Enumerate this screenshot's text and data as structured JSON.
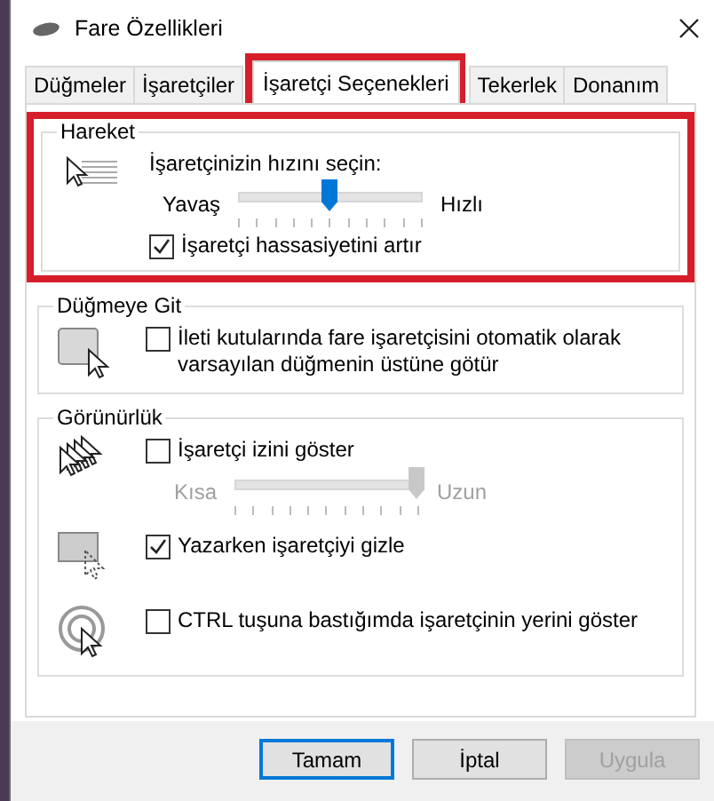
{
  "window": {
    "title": "Fare Özellikleri"
  },
  "tabs": [
    {
      "label": "Düğmeler",
      "selected": false,
      "highlighted": false
    },
    {
      "label": "İşaretçiler",
      "selected": false,
      "highlighted": false
    },
    {
      "label": "İşaretçi Seçenekleri",
      "selected": true,
      "highlighted": true
    },
    {
      "label": "Tekerlek",
      "selected": false,
      "highlighted": false
    },
    {
      "label": "Donanım",
      "selected": false,
      "highlighted": false
    }
  ],
  "groups": [
    {
      "title": "Hareket",
      "highlighted": true,
      "sections": [
        {
          "items": [
            {
              "kind": "text",
              "text": "İşaretçinizin hızını seçin:"
            },
            {
              "kind": "slider",
              "min_label": "Yavaş",
              "max_label": "Hızlı",
              "level": 0.5,
              "disabled": false
            },
            {
              "kind": "checkbox",
              "label": "İşaretçi hassasiyetini artır",
              "checked": true
            }
          ]
        }
      ]
    },
    {
      "title": "Düğmeye Git",
      "highlighted": false,
      "sections": [
        {
          "items": [
            {
              "kind": "checkbox",
              "label": "İleti kutularında fare işaretçisini otomatik olarak varsayılan düğmenin üstüne götür",
              "checked": false
            }
          ]
        }
      ]
    },
    {
      "title": "Görünürlük",
      "highlighted": false,
      "sections": [
        {
          "items": [
            {
              "kind": "checkbox",
              "label": "İşaretçi izini göster",
              "checked": false
            },
            {
              "kind": "slider",
              "min_label": "Kısa",
              "max_label": "Uzun",
              "level": 1,
              "disabled": true
            }
          ]
        },
        {
          "items": [
            {
              "kind": "checkbox",
              "label": "Yazarken işaretçiyi gizle",
              "checked": true
            }
          ]
        },
        {
          "items": [
            {
              "kind": "checkbox",
              "label": "CTRL tuşuna bastığımda işaretçinin yerini göster",
              "checked": false
            }
          ]
        }
      ]
    }
  ],
  "buttons": [
    {
      "label": "Tamam",
      "default": true,
      "disabled": false
    },
    {
      "label": "İptal",
      "default": false,
      "disabled": false
    },
    {
      "label": "Uygula",
      "default": false,
      "disabled": true
    }
  ]
}
